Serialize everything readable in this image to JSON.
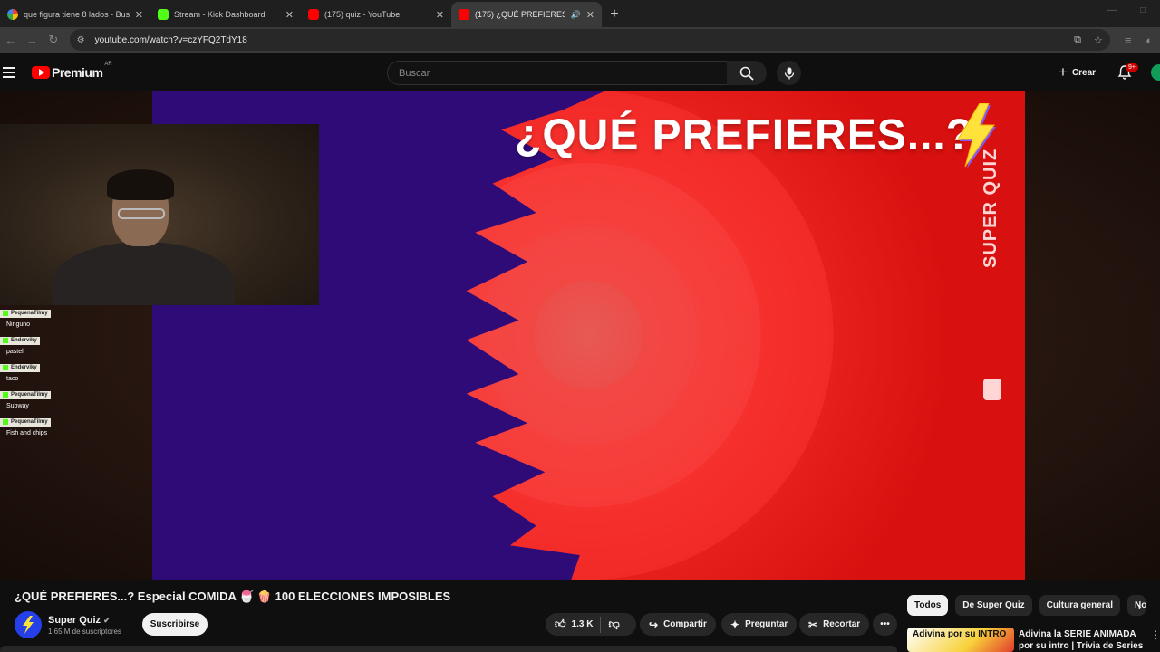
{
  "browser": {
    "tabs": [
      {
        "title": "que figura tiene 8 lados - Busca",
        "favicon": "google",
        "active": false
      },
      {
        "title": "Stream - Kick Dashboard",
        "favicon": "kick",
        "active": false
      },
      {
        "title": "(175) quiz - YouTube",
        "favicon": "youtube",
        "active": false
      },
      {
        "title": "(175) ¿QUÉ PREFIERES...? Es",
        "favicon": "youtube",
        "active": true
      }
    ],
    "url": "youtube.com/watch?v=czYFQ2TdY18"
  },
  "youtube": {
    "logo_text": "Premium",
    "country_code": "AR",
    "search_placeholder": "Buscar",
    "create_label": "Crear",
    "notification_count": "9+"
  },
  "video": {
    "headline": "¿QUÉ PREFIERES...?",
    "brand_text": "SUPER QUIZ",
    "accent_red": "#f22a27",
    "accent_purple": "#2f0b78"
  },
  "chat": [
    {
      "user": "PequenaTilmy",
      "text": "Ninguno"
    },
    {
      "user": "Enderviky",
      "text": "pastel"
    },
    {
      "user": "Enderviky",
      "text": "taco"
    },
    {
      "user": "PequenaTilmy",
      "text": "Subway"
    },
    {
      "user": "PequenaTilmy",
      "text": "Fish and chips"
    }
  ],
  "meta": {
    "title": "¿QUÉ PREFIERES...? Especial COMIDA 🍧 🍿 100 ELECCIONES IMPOSIBLES",
    "channel_name": "Super Quiz",
    "subscribers": "1.65 M de suscriptores",
    "subscribe_label": "Suscribirse",
    "like_count": "1.3 K",
    "share_label": "Compartir",
    "ask_label": "Preguntar",
    "clip_label": "Recortar"
  },
  "chips": [
    "Todos",
    "De Super Quiz",
    "Cultura general",
    "No"
  ],
  "recommendation": {
    "thumb_text": "Adivina por su INTRO",
    "title": "Adivina la SERIE ANIMADA por su intro | Trivia de Series"
  }
}
